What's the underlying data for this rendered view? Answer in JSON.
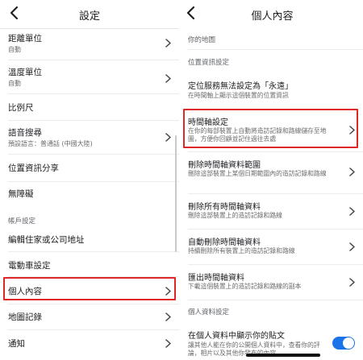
{
  "left": {
    "title": "設定",
    "items": [
      {
        "label": "距離單位",
        "sub": "自動"
      },
      {
        "label": "溫度單位",
        "sub": "自動"
      },
      {
        "label": "比例尺"
      },
      {
        "label": "語音搜尋",
        "sub": "預設語言：普通話 (中國大陸)"
      },
      {
        "label": "位置資訊分享"
      },
      {
        "label": "無障礙"
      },
      {
        "label": "編輯住家或公司地址"
      },
      {
        "label": "電動車設定"
      },
      {
        "label": "個人內容"
      },
      {
        "label": "地圖記錄"
      },
      {
        "label": "通知"
      }
    ],
    "section_account": "帳戶設定"
  },
  "right": {
    "title": "個人內容",
    "section_map": "你的地圖",
    "section_location": "位置資訊設定",
    "items": [
      {
        "label": "定位服務無法設定為「永遠」",
        "sub": "在時間軸上顯示這個裝置的位置資訊"
      },
      {
        "label": "時間軸設定",
        "sub": "在你的每部裝置上自動將造訪記錄和路線儲存至地圖，方便你回顧並記住過往去處"
      },
      {
        "label": "刪除時間軸資料範圍",
        "sub": "刪除這部裝置上某個日期範圍內的造訪記錄和路線"
      },
      {
        "label": "刪除所有時間軸資料",
        "sub": "刪除這部裝置上的造訪記錄和路線"
      },
      {
        "label": "自動刪除時間軸資料",
        "sub": "持續刪除所有裝置上的造訪記錄和路線"
      },
      {
        "label": "匯出時間軸資料",
        "sub": "下載這個裝置上的造訪記錄和路線的副本"
      },
      {
        "label": "在個人資料中顯示你的貼文",
        "sub": "讓其他人能在你的公開個人資料中，查看你的評論，相片以及其他你發布的內容"
      }
    ],
    "section_profile": "個人資料設定"
  },
  "colors": {
    "highlight": "#e02727",
    "toggle_on": "#1a73e8"
  },
  "icons": {
    "back": "chevron-left-icon",
    "row": "chevron-right-icon"
  }
}
